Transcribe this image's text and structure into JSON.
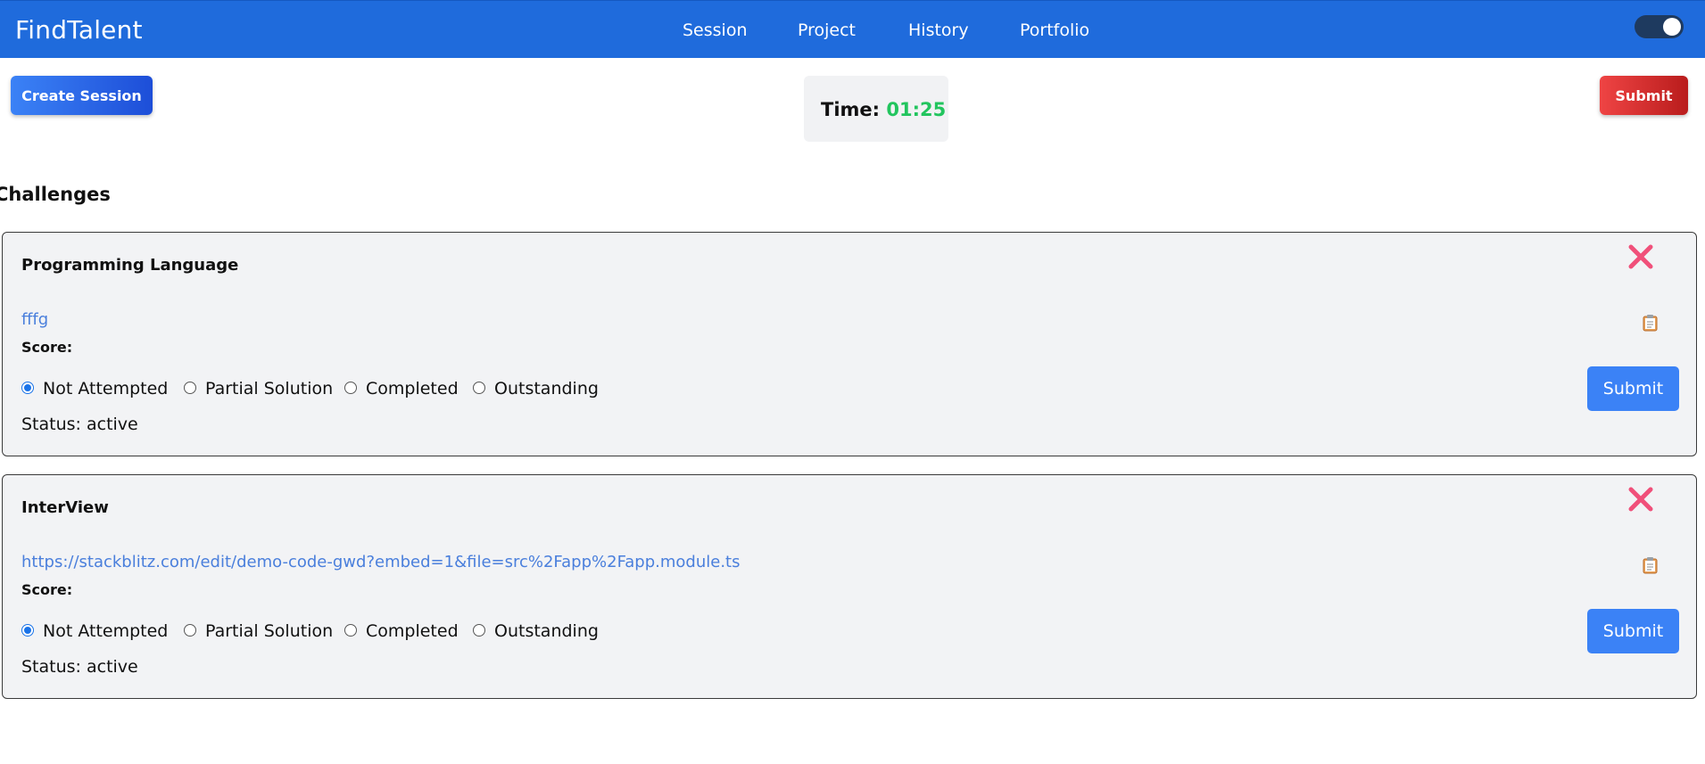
{
  "navbar": {
    "brand": "FindTalent",
    "links": [
      "Session",
      "Project",
      "History",
      "Portfolio"
    ],
    "theme_toggle_on": true
  },
  "toolbar": {
    "create_label": "Create Session",
    "submit_label": "Submit"
  },
  "timer": {
    "label": "Time:",
    "value": "01:25",
    "value_color": "#22c55e"
  },
  "section_title": "Challenges",
  "challenges": [
    {
      "title": "Programming Language",
      "link": "fffg",
      "score_label": "Score:",
      "options": [
        "Not Attempted",
        "Partial Solution",
        "Completed",
        "Outstanding"
      ],
      "selected": "Not Attempted",
      "status": "Status: active",
      "submit_label": "Submit"
    },
    {
      "title": "InterView",
      "link": "https://stackblitz.com/edit/demo-code-gwd?embed=1&file=src%2Fapp%2Fapp.module.ts",
      "score_label": "Score:",
      "options": [
        "Not Attempted",
        "Partial Solution",
        "Completed",
        "Outstanding"
      ],
      "selected": "Not Attempted",
      "status": "Status: active",
      "submit_label": "Submit"
    }
  ],
  "icons": {
    "close": "close-icon",
    "clipboard": "clipboard-icon"
  },
  "colors": {
    "navbar": "#1f6bdc",
    "primary": "#3b82f6",
    "danger": "#ef4444",
    "close_icon": "#f0507a",
    "link": "#4a7fdc"
  }
}
